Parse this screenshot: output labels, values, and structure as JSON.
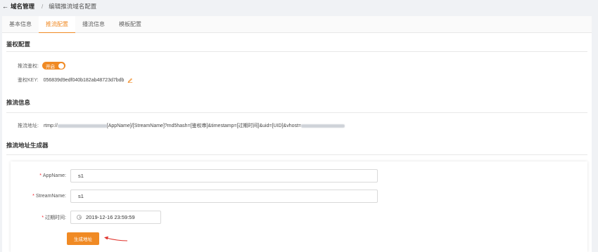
{
  "breadcrumb": {
    "back_arrow": "←",
    "root": "域名管理",
    "separator": "/",
    "current": "编辑推流域名配置"
  },
  "tabs": [
    {
      "label": "基本信息"
    },
    {
      "label": "推流配置",
      "active": true
    },
    {
      "label": "播流信息"
    },
    {
      "label": "模板配置"
    }
  ],
  "auth": {
    "section_title": "鉴权配置",
    "toggle_label": "推流鉴权:",
    "toggle_state": "开启",
    "key_label": "鉴权KEY:",
    "key_value": "056839d9edf040b182ab48723d7bdb"
  },
  "push_info": {
    "section_title": "推流信息",
    "address_label": "推流地址:",
    "address_prefix": "rtmp://",
    "address_middle": "[AppName]/[StreamName]?md5hash=[鉴权串]&timestamp=[过期时间]&uid=[UID]&vhost="
  },
  "generator": {
    "section_title": "推流地址生成器",
    "required_mark": "*",
    "app_name_label": "AppName:",
    "app_name_value": "s1",
    "stream_name_label": "StreamName:",
    "stream_name_value": "s1",
    "expire_label": "过期时间:",
    "expire_value": "2019-12-16 23:59:59",
    "button_label": "生成地址"
  },
  "colors": {
    "accent": "#f08a24",
    "required": "#f5222d",
    "annotation_arrow": "#e0322b"
  },
  "icons": {
    "edit": "edit-icon",
    "clock": "clock-icon",
    "back": "back-arrow-icon"
  }
}
